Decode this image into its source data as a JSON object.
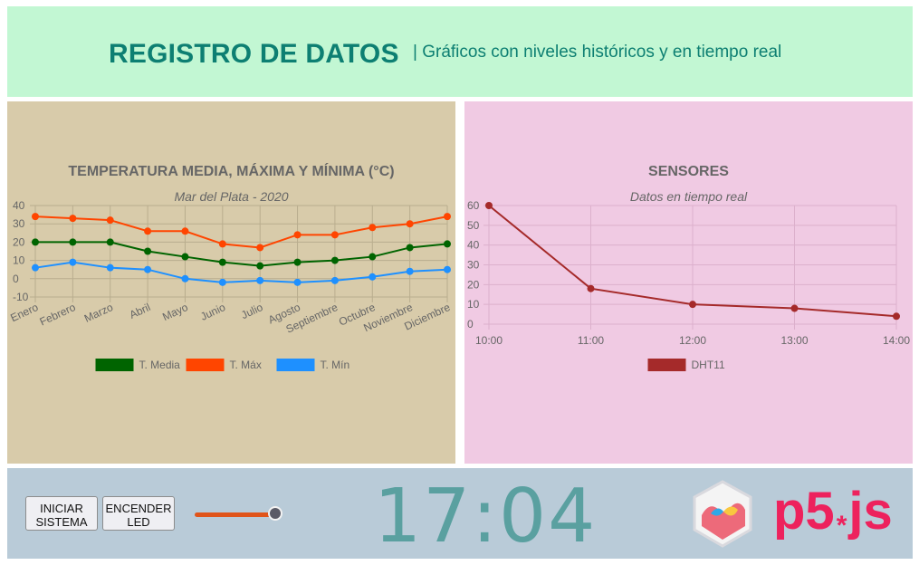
{
  "header": {
    "title": "REGISTRO DE DATOS",
    "subtitle": "| Gráficos con niveles históricos y en tiempo real"
  },
  "chart_data": [
    {
      "type": "line",
      "title": "TEMPERATURA MEDIA, MÁXIMA Y MÍNIMA (°C)",
      "subtitle": "Mar del Plata - 2020",
      "categories": [
        "Enero",
        "Febrero",
        "Marzo",
        "Abril",
        "Mayo",
        "Junio",
        "Julio",
        "Agosto",
        "Septiembre",
        "Octubre",
        "Noviembre",
        "Diciembre"
      ],
      "yticks": [
        "40",
        "30",
        "20",
        "10",
        "0",
        "-10"
      ],
      "ylim": [
        -10,
        40
      ],
      "grid": true,
      "legend": "bottom",
      "series": [
        {
          "name": "T. Media",
          "color": "#006400",
          "values": [
            20,
            20,
            20,
            15,
            12,
            9,
            7,
            9,
            10,
            12,
            17,
            19
          ]
        },
        {
          "name": "T. Máx",
          "color": "#ff4500",
          "values": [
            34,
            33,
            32,
            26,
            26,
            19,
            17,
            24,
            24,
            28,
            30,
            34
          ]
        },
        {
          "name": "T. Mín",
          "color": "#1e90ff",
          "values": [
            6,
            9,
            6,
            5,
            0,
            -2,
            -1,
            -2,
            -1,
            1,
            4,
            5
          ]
        }
      ]
    },
    {
      "type": "line",
      "title": "SENSORES",
      "subtitle": "Datos en tiempo real",
      "categories": [
        "10:00",
        "11:00",
        "12:00",
        "13:00",
        "14:00"
      ],
      "yticks": [
        "60",
        "50",
        "40",
        "30",
        "20",
        "10",
        "0"
      ],
      "ylim": [
        0,
        60
      ],
      "grid": true,
      "legend": "bottom",
      "series": [
        {
          "name": "DHT11",
          "color": "#a52a2a",
          "values": [
            60,
            18,
            10,
            8,
            4
          ]
        }
      ]
    }
  ],
  "footer": {
    "btn_start_line1": "INICIAR",
    "btn_start_line2": "SISTEMA",
    "btn_led_line1": "ENCENDER",
    "btn_led_line2": "LED",
    "slider_value": 1.0,
    "clock": "17:04",
    "logo_main": "p5",
    "logo_star": "*",
    "logo_suffix": "js"
  }
}
